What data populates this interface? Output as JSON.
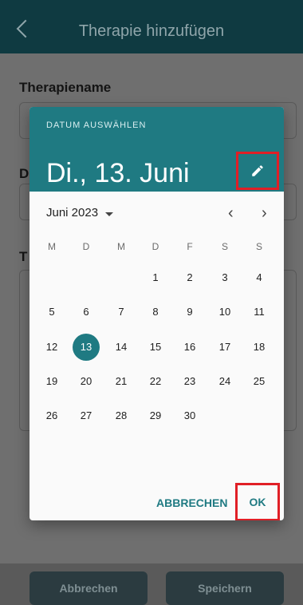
{
  "header": {
    "title": "Therapie hinzufügen"
  },
  "form": {
    "label1": "Therapiename",
    "label2": "D",
    "label3": "T"
  },
  "bottom": {
    "cancel": "Abbrechen",
    "save": "Speichern"
  },
  "dialog": {
    "heading_small": "DATUM AUSWÄHLEN",
    "selected_date": "Di., 13. Juni",
    "month_label": "Juni 2023",
    "weekdays": [
      "M",
      "D",
      "M",
      "D",
      "F",
      "S",
      "S"
    ],
    "days": [
      [
        "",
        "",
        "",
        "1",
        "2",
        "3",
        "4"
      ],
      [
        "5",
        "6",
        "7",
        "8",
        "9",
        "10",
        "11"
      ],
      [
        "12",
        "13",
        "14",
        "15",
        "16",
        "17",
        "18"
      ],
      [
        "19",
        "20",
        "21",
        "22",
        "23",
        "24",
        "25"
      ],
      [
        "26",
        "27",
        "28",
        "29",
        "30",
        "",
        ""
      ]
    ],
    "cancel": "ABBRECHEN",
    "ok": "OK"
  },
  "icons": {
    "back": "chevron-left-icon",
    "edit": "pencil-icon",
    "month_dropdown": "triangle-down-icon",
    "prev": "chevron-left-icon",
    "next": "chevron-right-icon"
  },
  "colors": {
    "header_bg": "#0f3a41",
    "accent": "#1f7a82",
    "highlight_box": "#e01f26"
  }
}
